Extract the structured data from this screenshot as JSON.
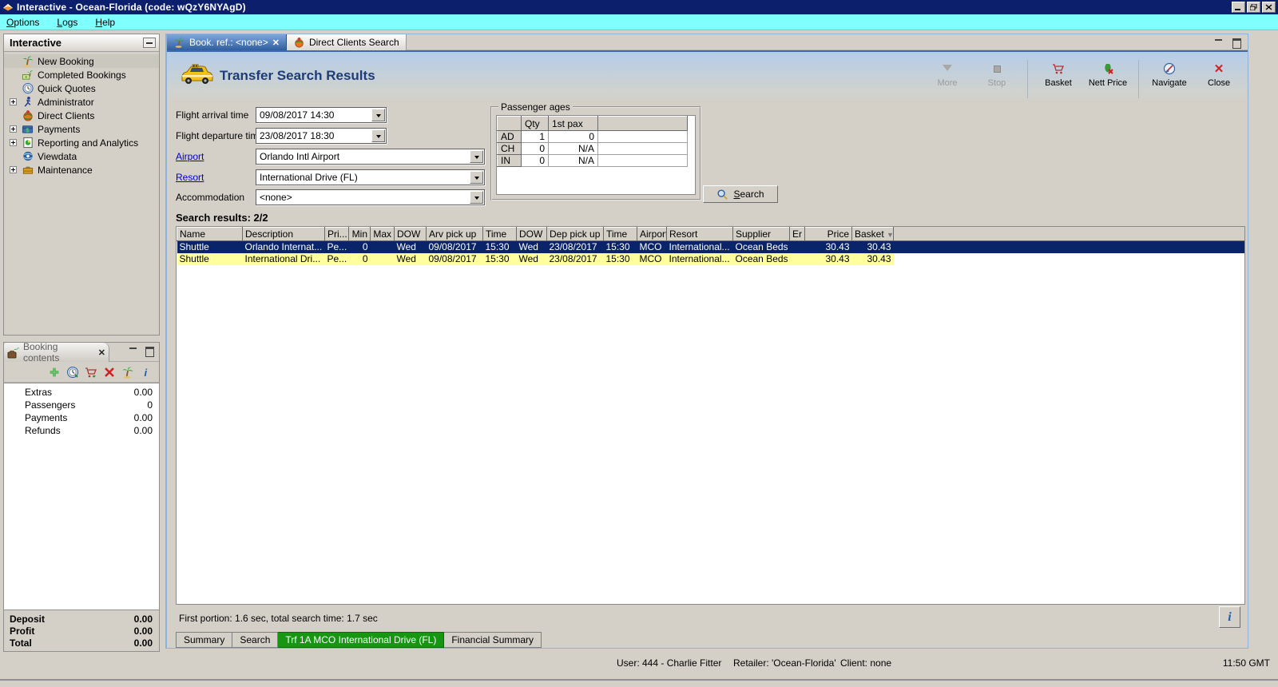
{
  "window": {
    "title": "Interactive - Ocean-Florida (code: wQzY6NYAgD)"
  },
  "menu": {
    "items": [
      {
        "u": "O",
        "rest": "ptions"
      },
      {
        "u": "L",
        "rest": "ogs"
      },
      {
        "u": "H",
        "rest": "elp"
      }
    ]
  },
  "sidebar": {
    "title": "Interactive",
    "items": [
      {
        "label": "New Booking"
      },
      {
        "label": "Completed Bookings"
      },
      {
        "label": "Quick Quotes"
      },
      {
        "label": "Administrator"
      },
      {
        "label": "Direct Clients"
      },
      {
        "label": "Payments"
      },
      {
        "label": "Reporting and Analytics"
      },
      {
        "label": "Viewdata"
      },
      {
        "label": "Maintenance"
      }
    ]
  },
  "booking_panel": {
    "title": "Booking contents",
    "rows": [
      {
        "label": "Extras",
        "value": "0.00"
      },
      {
        "label": "Passengers",
        "value": "0"
      },
      {
        "label": "Payments",
        "value": "0.00"
      },
      {
        "label": "Refunds",
        "value": "0.00"
      }
    ],
    "totals": [
      {
        "label": "Deposit",
        "value": "0.00"
      },
      {
        "label": "Profit",
        "value": "0.00"
      },
      {
        "label": "Total",
        "value": "0.00"
      }
    ]
  },
  "tabs": {
    "active": "Book. ref.: <none>",
    "inactive": "Direct Clients Search"
  },
  "header": {
    "title": "Transfer Search Results"
  },
  "toolbar": {
    "more": "More",
    "stop": "Stop",
    "basket": "Basket",
    "nett_price": "Nett Price",
    "navigate": "Navigate",
    "close": "Close"
  },
  "form": {
    "arrival": {
      "label": "Flight arrival time",
      "value": "09/08/2017 14:30"
    },
    "departure": {
      "label": "Flight departure time",
      "value": "23/08/2017 18:30"
    },
    "airport": {
      "label": "Airport",
      "value": "Orlando Intl Airport"
    },
    "resort": {
      "label": "Resort",
      "value": "International Drive (FL)"
    },
    "accommodation": {
      "label": "Accommodation",
      "value": "<none>"
    }
  },
  "passenger_ages": {
    "legend": "Passenger ages",
    "columns": {
      "qty": "Qty",
      "first_pax": "1st pax"
    },
    "rows": [
      {
        "code": "AD",
        "qty": "1",
        "first_pax": "0"
      },
      {
        "code": "CH",
        "qty": "0",
        "first_pax": "N/A"
      },
      {
        "code": "IN",
        "qty": "0",
        "first_pax": "N/A"
      }
    ]
  },
  "search_button": {
    "u": "S",
    "rest": "earch"
  },
  "results": {
    "label": "Search results: 2/2",
    "columns": [
      "Name",
      "Description",
      "Pri...",
      "Min",
      "Max",
      "DOW",
      "Arv pick up",
      "Time",
      "DOW",
      "Dep pick up",
      "Time",
      "Airport",
      "Resort",
      "Supplier",
      "Er",
      "Price",
      "Basket"
    ],
    "rows": [
      [
        "Shuttle",
        "Orlando Internat...",
        "Pe...",
        "0",
        "",
        "Wed",
        "09/08/2017",
        "15:30",
        "Wed",
        "23/08/2017",
        "15:30",
        "MCO",
        "International...",
        "Ocean Beds",
        "",
        "30.43",
        "30.43"
      ],
      [
        "Shuttle",
        "International Dri...",
        "Pe...",
        "0",
        "",
        "Wed",
        "09/08/2017",
        "15:30",
        "Wed",
        "23/08/2017",
        "15:30",
        "MCO",
        "International...",
        "Ocean Beds",
        "",
        "30.43",
        "30.43"
      ]
    ],
    "timing": "First portion: 1.6 sec, total search time: 1.7 sec"
  },
  "bottom_tabs": [
    {
      "label": "Summary"
    },
    {
      "label": "Search"
    },
    {
      "label": "Trf 1A MCO International Drive (FL)"
    },
    {
      "label": "Financial Summary"
    }
  ],
  "statusbar": {
    "user": "User: 444 - Charlie Fitter",
    "retailer": "Retailer: 'Ocean-Florida'",
    "client": "Client: none",
    "time": "11:50 GMT"
  },
  "info_button": "i"
}
